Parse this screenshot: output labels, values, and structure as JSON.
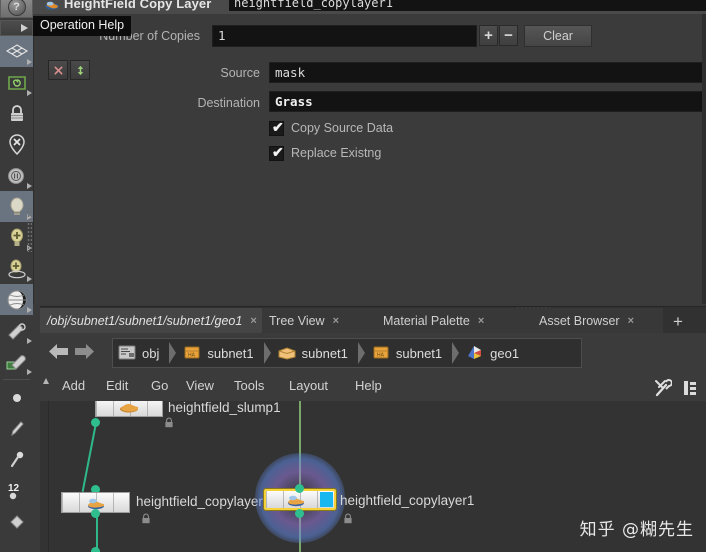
{
  "dialog": {
    "title": "HeightField Copy Layer",
    "node_name_field": "heightfield_copylayer1",
    "title_icon": "heightfield-node-icon",
    "help_icon": "question-mark-icon",
    "tooltip": "Operation Help",
    "params": [
      {
        "label": "Number of Copies",
        "value": "1"
      },
      {
        "label": "Source",
        "value": "mask"
      },
      {
        "label": "Destination",
        "value": "Grass"
      }
    ],
    "number_of_copies_label": "Number of Copies",
    "number_of_copies_value": "1",
    "source_label": "Source",
    "source_value": "mask",
    "destination_label": "Destination",
    "destination_value": "Grass",
    "plus_button": "+",
    "minus_button": "−",
    "clear_button": "Clear",
    "delete_button_icon": "red-x-icon",
    "reorder_button_icon": "green-updown-arrow-icon",
    "checkboxes": [
      {
        "label": "Copy Source Data",
        "checked": true
      },
      {
        "label": "Replace Existng",
        "checked": true
      }
    ],
    "checkmark_glyph": "✔"
  },
  "viewport_toolbar": {
    "items": [
      {
        "name": "select-tool",
        "icon": "diamond-grid-icon",
        "selected": true,
        "has_flyout": true
      },
      {
        "name": "snap-tool",
        "icon": "green-spiral-icon",
        "selected": false,
        "has_flyout": true
      },
      {
        "name": "lock-tool",
        "icon": "padlock-icon",
        "selected": false,
        "has_flyout": false
      },
      {
        "name": "no-pivot-tool",
        "icon": "x-circle-pin-icon",
        "selected": false,
        "has_flyout": false
      },
      {
        "name": "handle-tool",
        "icon": "coin-handle-icon",
        "selected": false,
        "has_flyout": true
      },
      {
        "name": "light-tool",
        "icon": "lightbulb-icon",
        "selected": true,
        "has_flyout": true
      },
      {
        "name": "add-light-tool",
        "icon": "lightbulb-plus-icon",
        "selected": false,
        "has_flyout": true
      },
      {
        "name": "add-light-orbit-tool",
        "icon": "lightbulb-plus-orbit-icon",
        "selected": false,
        "has_flyout": true
      },
      {
        "name": "material-tool",
        "icon": "checkered-sphere-icon",
        "selected": true,
        "has_flyout": true
      },
      {
        "name": "paint-tool",
        "icon": "eyedropper-mask-icon",
        "selected": false,
        "has_flyout": true
      },
      {
        "name": "paint-layer-tool",
        "icon": "eyedropper-layer-icon",
        "selected": false,
        "has_flyout": true
      },
      {
        "name": "point-tool",
        "icon": "single-point-icon",
        "selected": false,
        "has_flyout": false
      },
      {
        "name": "brush-tool",
        "icon": "brush-icon",
        "selected": false,
        "has_flyout": false
      },
      {
        "name": "pin-tool",
        "icon": "pin-icon",
        "selected": false,
        "has_flyout": false
      },
      {
        "name": "number-tool",
        "icon": "number-12-point-icon",
        "label": "12",
        "selected": false,
        "has_flyout": false
      },
      {
        "name": "fill-tool",
        "icon": "paint-bucket-icon",
        "selected": false,
        "has_flyout": false
      }
    ]
  },
  "tabs": [
    {
      "label": "/obj/subnet1/subnet1/subnet1/geo1",
      "active": true,
      "closable": true
    },
    {
      "label": "Tree View",
      "active": false,
      "closable": true
    },
    {
      "label": "Material Palette",
      "active": false,
      "closable": true
    },
    {
      "label": "Asset Browser",
      "active": false,
      "closable": true
    }
  ],
  "tab_close_glyph": "×",
  "tab_add_glyph": "+",
  "breadcrumb": {
    "back_icon": "back-arrow-icon",
    "forward_icon": "forward-arrow-icon",
    "items": [
      {
        "label": "obj",
        "icon": "obj-network-icon"
      },
      {
        "label": "subnet1",
        "icon": "subnet-box-icon"
      },
      {
        "label": "subnet1",
        "icon": "open-box-icon"
      },
      {
        "label": "subnet1",
        "icon": "subnet-box-icon"
      },
      {
        "label": "geo1",
        "icon": "geometry-icon"
      }
    ]
  },
  "menubar": {
    "items": [
      "Add",
      "Edit",
      "Go",
      "View",
      "Tools",
      "Layout",
      "Help"
    ],
    "right_icons": [
      {
        "name": "tools-wrench-icon"
      },
      {
        "name": "node-list-icon"
      }
    ]
  },
  "graph": {
    "nodes": [
      {
        "label": "heightfield_slump1",
        "selected": false,
        "locked": true
      },
      {
        "label": "heightfield_copylayer",
        "selected": false,
        "locked": true
      },
      {
        "label": "heightfield_copylayer1",
        "selected": true,
        "locked": true,
        "display_flag": true
      }
    ]
  },
  "watermark": "知乎 @糊先生",
  "colors": {
    "panel_bg": "#3b3b3b",
    "field_bg": "#131313",
    "selection_yellow": "#f5d23a",
    "wire_green": "#2fbf8f",
    "display_flag_blue": "#19b7ef",
    "tab_active": "#454545"
  }
}
